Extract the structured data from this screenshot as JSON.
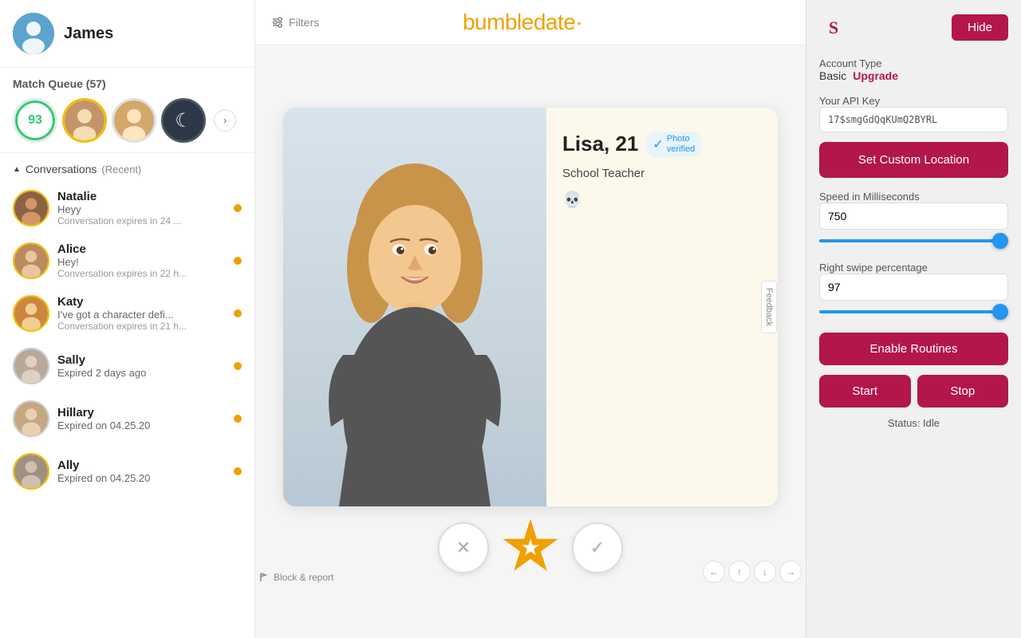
{
  "sidebar": {
    "user_name": "James",
    "match_queue_label": "Match Queue",
    "match_queue_count": "(57)",
    "score_value": "93",
    "conversations_label": "Conversations",
    "conversations_sub": "(Recent)",
    "conversations": [
      {
        "name": "Natalie",
        "message": "Heyy",
        "expires": "Conversation expires in 24 ...",
        "has_dot": true,
        "ring_color": "gold",
        "avatar_class": "av-natalie"
      },
      {
        "name": "Alice",
        "message": "Hey!",
        "expires": "Conversation expires in 22 h...",
        "has_dot": true,
        "ring_color": "gold",
        "avatar_class": "av-alice"
      },
      {
        "name": "Katy",
        "message": "I've got a character defi...",
        "expires": "Conversation expires in 21 h...",
        "has_dot": true,
        "ring_color": "gold",
        "avatar_class": "av-katy"
      },
      {
        "name": "Sally",
        "message": "Expired 2 days ago",
        "expires": "",
        "has_dot": true,
        "ring_color": "gray",
        "avatar_class": "av-sally"
      },
      {
        "name": "Hillary",
        "message": "Expired on 04.25.20",
        "expires": "",
        "has_dot": true,
        "ring_color": "gray",
        "avatar_class": "av-hillary"
      },
      {
        "name": "Ally",
        "message": "Expired on 04.25.20",
        "expires": "",
        "has_dot": true,
        "ring_color": "gold",
        "avatar_class": "av-ally"
      }
    ]
  },
  "header": {
    "filters_label": "Filters",
    "logo_text": "bumbledate·"
  },
  "profile": {
    "name": "Lisa, 21",
    "verified_label": "Photo",
    "verified_sub": "verified",
    "job": "School Teacher",
    "feedback_label": "Feedback"
  },
  "actions": {
    "block_report": "Block & report",
    "x_icon": "✕",
    "star_icon": "★",
    "check_icon": "✓"
  },
  "right_panel": {
    "hide_label": "Hide",
    "account_type_label": "Account Type",
    "basic_label": "Basic",
    "upgrade_label": "Upgrade",
    "api_key_label": "Your API Key",
    "api_key_value": "17$smgGdQqKUmQ2BYRL",
    "set_location_label": "Set Custom Location",
    "speed_label": "Speed in Milliseconds",
    "speed_value": "750",
    "speed_slider_pct": 95,
    "swipe_pct_label": "Right swipe percentage",
    "swipe_value": "97",
    "swipe_slider_pct": 97,
    "enable_routines_label": "Enable Routines",
    "start_label": "Start",
    "stop_label": "Stop",
    "status_label": "Status: Idle"
  }
}
